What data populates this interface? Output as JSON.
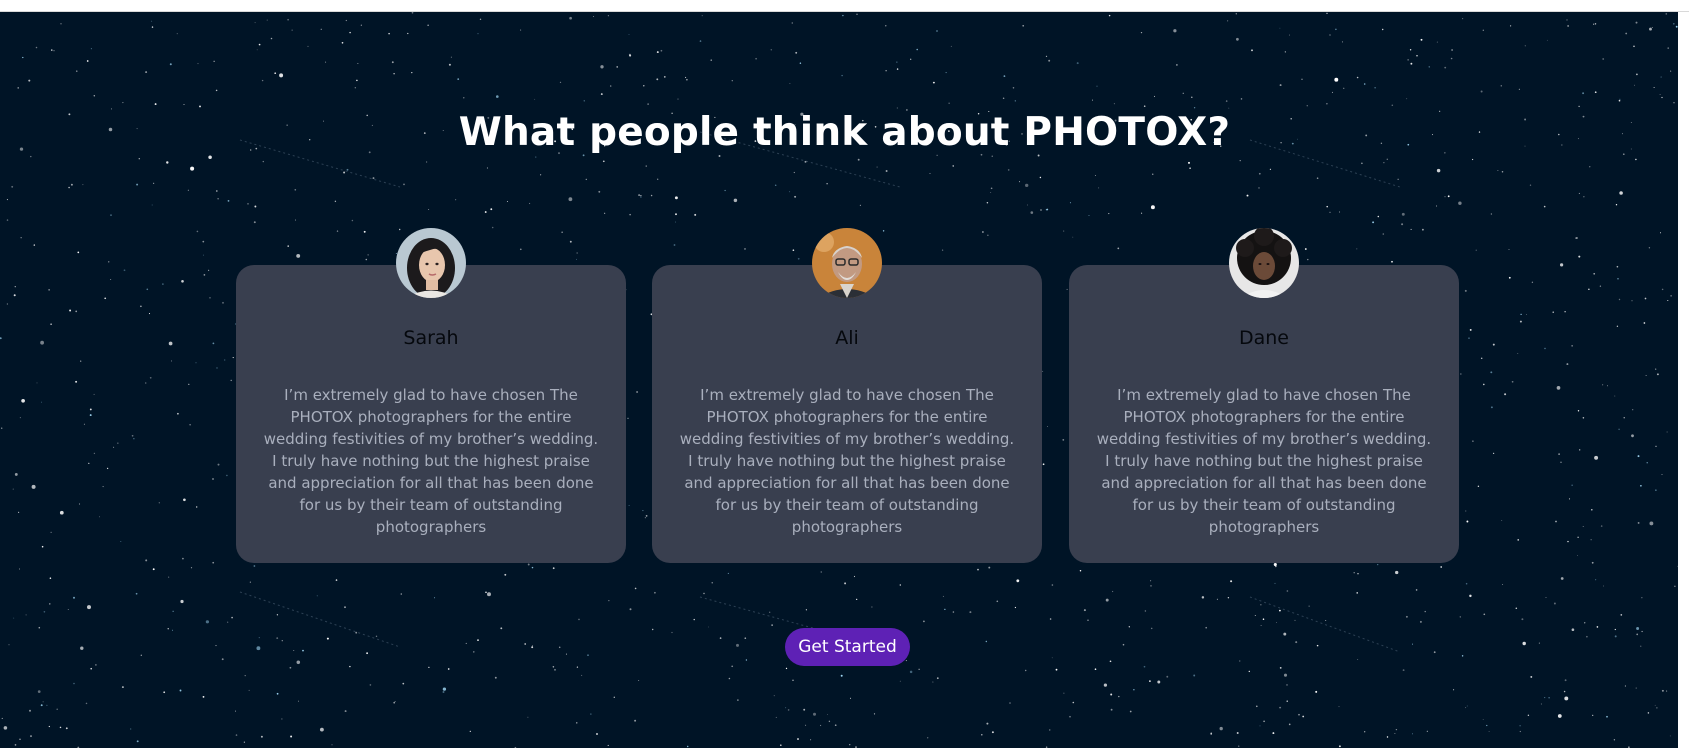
{
  "section": {
    "heading": "What people think about PHOTOX?"
  },
  "testimonials": [
    {
      "name": "Sarah",
      "avatar_icon": "woman-portrait-avatar",
      "quote": "I’m extremely glad to have chosen The PHOTOX photographers for the entire wedding festivities of my brother’s wedding. I truly have nothing but the highest praise and appreciation for all that has been done for us by their team of outstanding photographers"
    },
    {
      "name": "Ali",
      "avatar_icon": "older-man-portrait-avatar",
      "quote": "I’m extremely glad to have chosen The PHOTOX photographers for the entire wedding festivities of my brother’s wedding. I truly have nothing but the highest praise and appreciation for all that has been done for us by their team of outstanding photographers"
    },
    {
      "name": "Dane",
      "avatar_icon": "curly-hair-portrait-avatar",
      "quote": "I’m extremely glad to have chosen The PHOTOX photographers for the entire wedding festivities of my brother’s wedding. I truly have nothing but the highest praise and appreciation for all that has been done for us by their team of outstanding photographers"
    }
  ],
  "cta": {
    "label": "Get Started"
  },
  "colors": {
    "background": "#001426",
    "card": "#393f4f",
    "button": "#5e21b5",
    "heading": "#ffffff",
    "quote_text": "#a9afbd"
  }
}
